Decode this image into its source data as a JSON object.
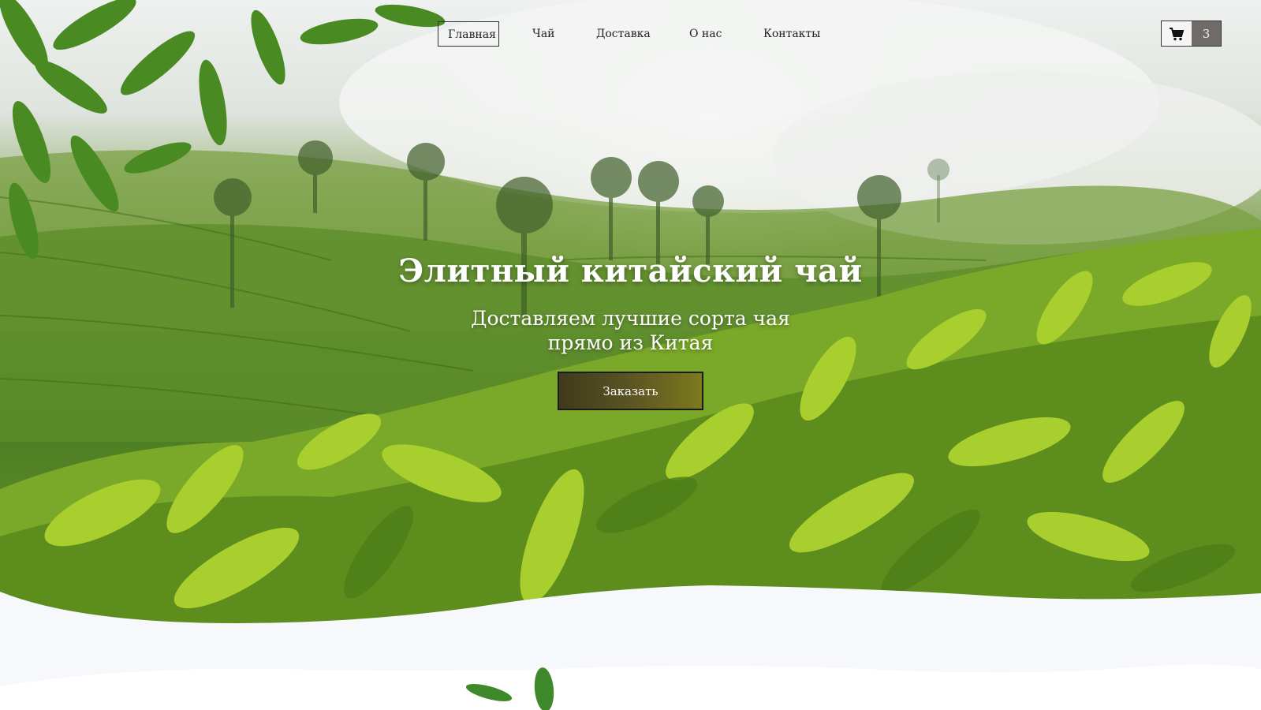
{
  "nav": {
    "items": [
      {
        "label": "Главная",
        "active": true
      },
      {
        "label": "Чай",
        "active": false
      },
      {
        "label": "Доставка",
        "active": false
      },
      {
        "label": "О нас",
        "active": false
      },
      {
        "label": "Контакты",
        "active": false
      }
    ]
  },
  "cart": {
    "icon": "shopping-cart-icon",
    "count": "3"
  },
  "hero": {
    "title": "Элитный китайский чай",
    "subtitle_line1": "Доставляем лучшие сорта чая",
    "subtitle_line2": "прямо из Китая",
    "order_button": "Заказать"
  },
  "colors": {
    "accent_button": "#5b5423",
    "cart_count_bg": "#6e6b68",
    "page_background": "#f7f8fb"
  }
}
